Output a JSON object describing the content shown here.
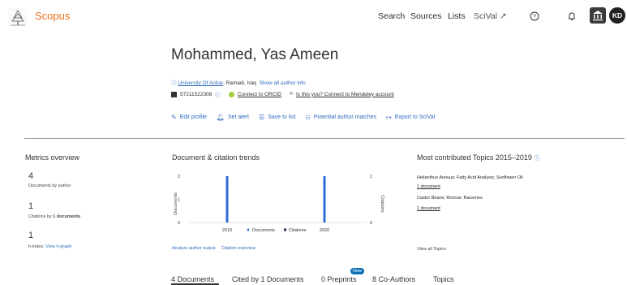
{
  "app": {
    "brand": "Scopus"
  },
  "nav": {
    "search": "Search",
    "sources": "Sources",
    "lists": "Lists",
    "scival": "SciVal ↗"
  },
  "user": {
    "initials": "KD"
  },
  "author": {
    "name": "Mohammed, Yas Ameen",
    "institution": "University Of Anbar",
    "location": ", Ramadi, Iraq",
    "show_all": "Show all author info",
    "author_id": "57211522308",
    "orcid": "Connect to ORCID",
    "mendeley": "Is this you? Connect to Mendeley account"
  },
  "actions": {
    "edit_profile": "Edit profile",
    "set_alert": "Set alert",
    "save_list": "Save to list",
    "matches": "Potential author matches",
    "export": "Export to SciVal"
  },
  "metrics": {
    "title": "Metrics overview",
    "documents_value": "4",
    "documents_label": "Documents by author",
    "citations_value": "1",
    "citations_label": "Citations by ",
    "citations_docs": "1 documents",
    "hindex_value": "1",
    "hindex_label": "h-index:",
    "hindex_link": "View h-graph"
  },
  "trends": {
    "title": "Document & citation trends",
    "ylabel_left": "Documents",
    "ylabel_right": "Citations",
    "left_ticks": [
      "2",
      "1",
      "0"
    ],
    "right_ticks": [
      "1",
      "0"
    ],
    "legend_docs": "Documents",
    "legend_cites": "Citations",
    "link_analyze": "Analyze author output",
    "link_overview": "Citation overview"
  },
  "chart_data": {
    "type": "bar",
    "categories": [
      "2019",
      "2020"
    ],
    "series": [
      {
        "name": "Documents",
        "values": [
          2,
          2
        ]
      },
      {
        "name": "Citations",
        "values": [
          0,
          0
        ]
      }
    ],
    "ylim_left": [
      0,
      2
    ],
    "ylim_right": [
      0,
      1
    ],
    "colors": {
      "Documents": "#2e6bd6",
      "Citations": "#1f2d59"
    }
  },
  "topics": {
    "title": "Most contributed Topics 2015–2019",
    "items": [
      {
        "label": "Helianthus Annuus; Fatty Acid Analysis; Sunflower Oil",
        "count": "1 document"
      },
      {
        "label": "Castor Beans; Ricinus; Racemes",
        "count": "1 document"
      }
    ],
    "view_all": "View all Topics"
  },
  "tabs": {
    "documents": "4 Documents",
    "cited_by": "Cited by 1 Documents",
    "preprints": "0 Preprints",
    "new_badge": "New",
    "coauthors": "8 Co-Authors",
    "topics": "Topics"
  }
}
